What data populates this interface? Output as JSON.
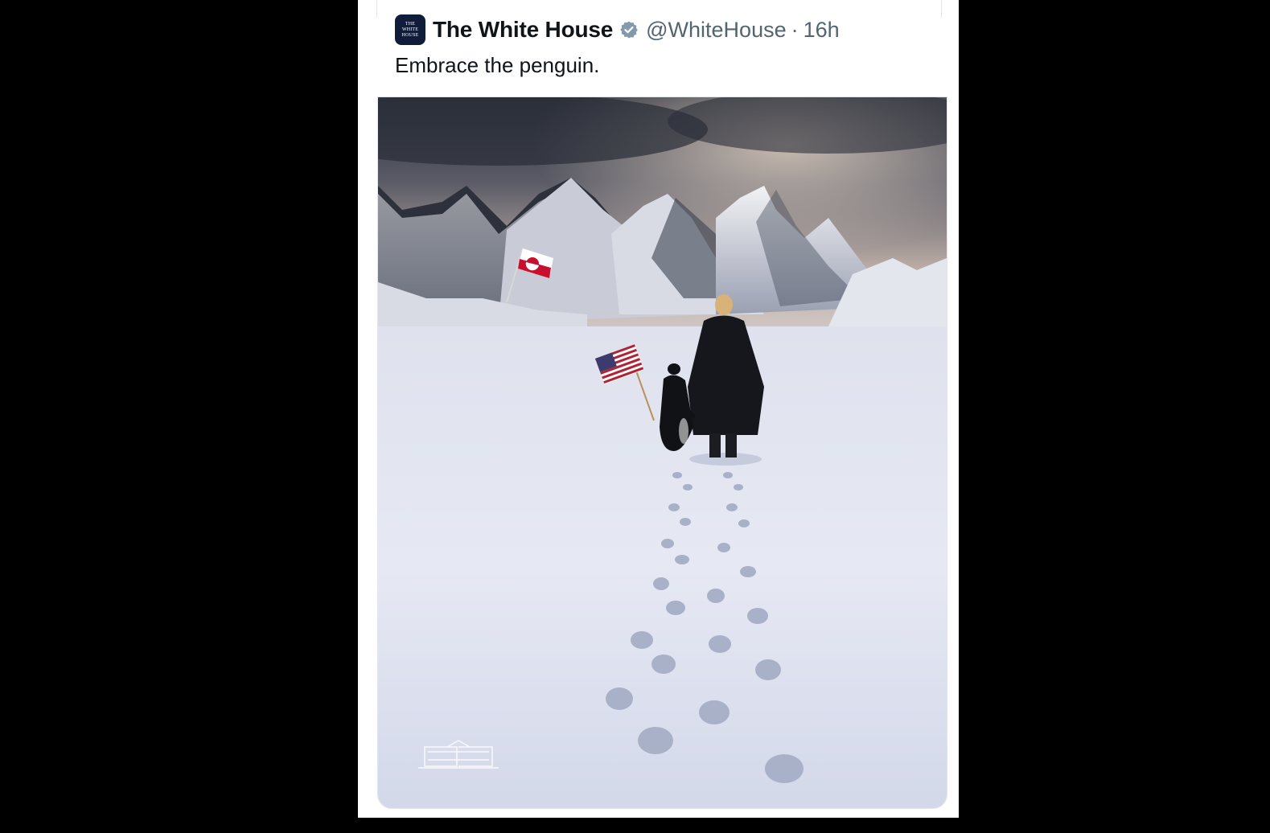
{
  "tweet": {
    "author_name": "The White House",
    "handle": "@WhiteHouse",
    "separator": "·",
    "time": "16h",
    "text": "Embrace the penguin.",
    "avatar_text_line1": "THE",
    "avatar_text_line2": "WHITE",
    "avatar_text_line3": "HOUSE",
    "verified_icon": "verified-badge-icon",
    "media": {
      "description_icon": "photo",
      "colors": {
        "sky_dark": "#3b3f4d",
        "sky_light": "#cbbfb7",
        "snow": "#e9ecf5",
        "snow_shadow": "#b9c0d6",
        "mountain": "#2c313b",
        "coat": "#14161b"
      }
    }
  }
}
